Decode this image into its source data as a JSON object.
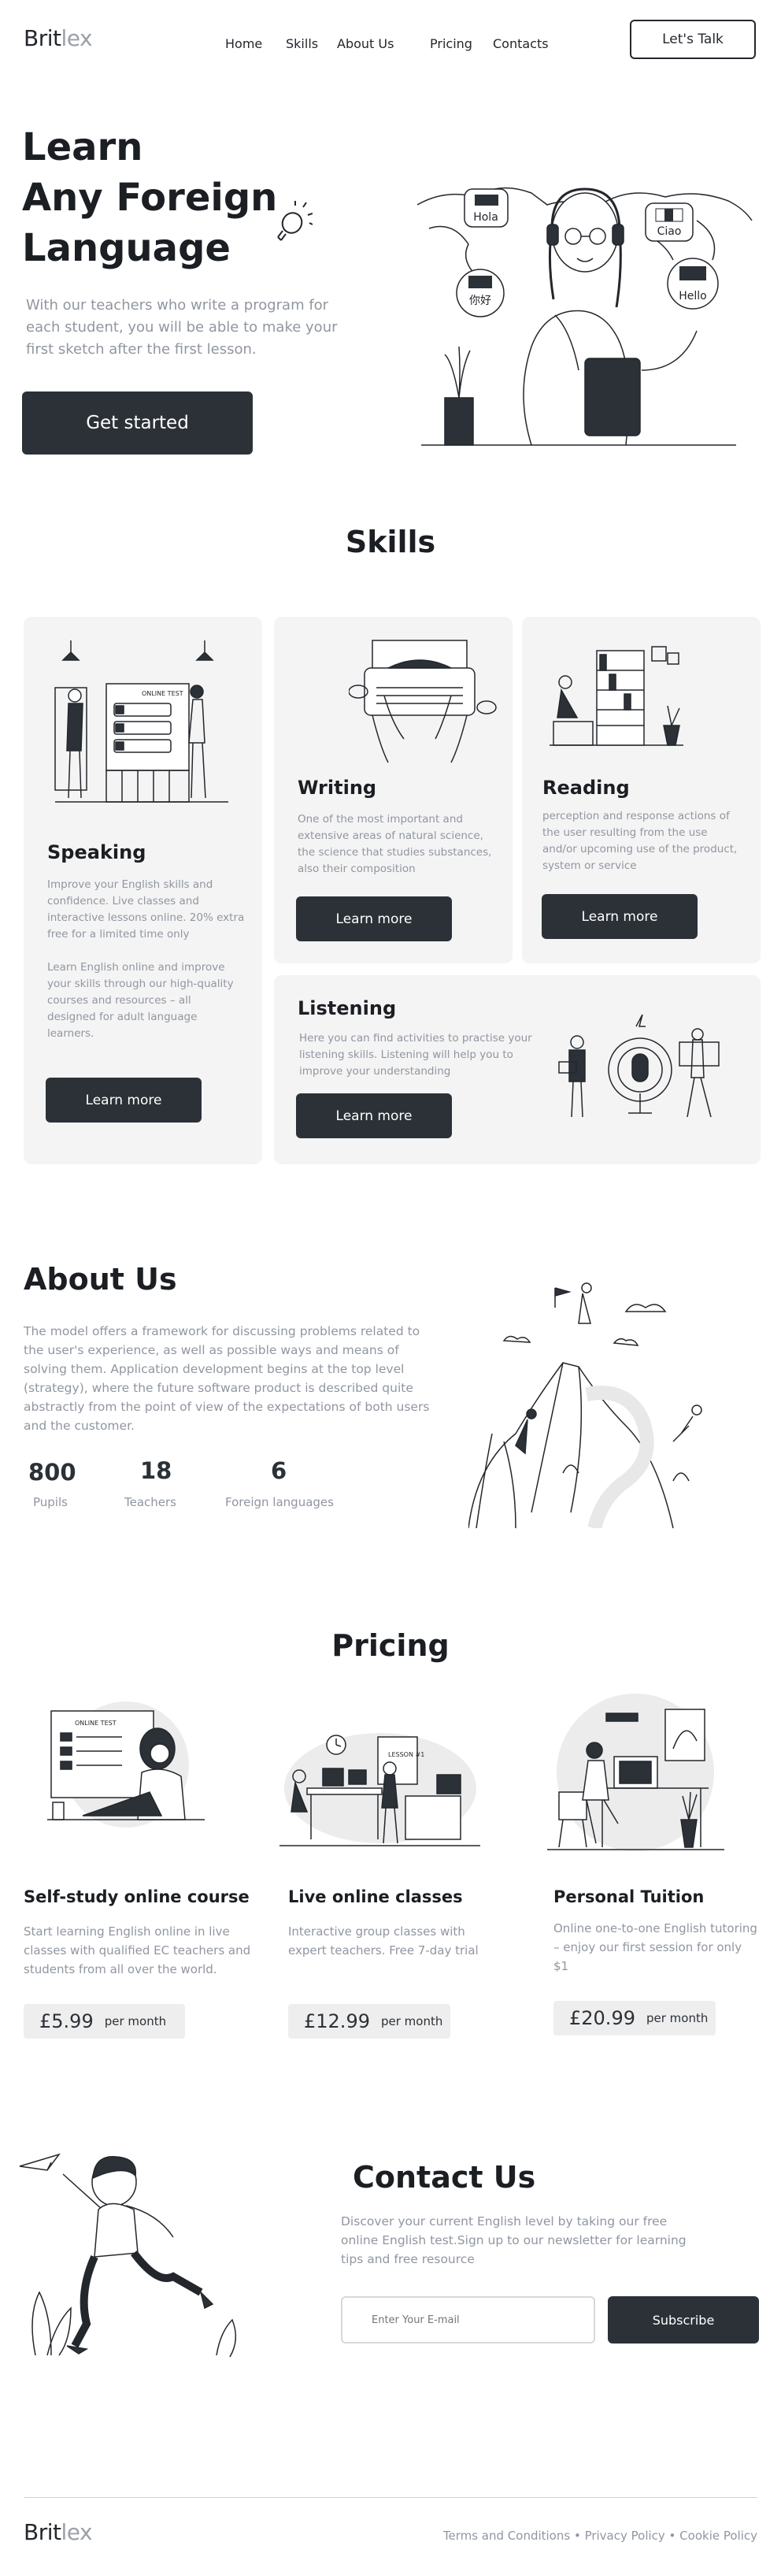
{
  "header": {
    "logo_a": "Brit",
    "logo_b": "lex",
    "nav": [
      "Home",
      "Skills",
      "About Us",
      "Pricing",
      "Contacts"
    ],
    "cta": "Let's Talk"
  },
  "hero": {
    "title_lines": [
      "Learn",
      "Any Foreign",
      "Language"
    ],
    "description": "With our teachers who write a program for each student, you will be able to make your first sketch after the first lesson.",
    "button": "Get started",
    "bubbles": [
      "Hola",
      "Ciao",
      "你好",
      "Hello"
    ]
  },
  "skills": {
    "heading": "Skills",
    "speaking": {
      "title": "Speaking",
      "p1": "Improve your English skills and confidence. Live classes and interactive lessons online. 20% extra free for a limited time only",
      "p2": "Learn English online and improve your skills through our high-quality courses and resources – all designed for adult language learners.",
      "button": "Learn more"
    },
    "writing": {
      "title": "Writing",
      "text": "One of the most important and extensive areas of natural science, the science that studies substances, also their composition",
      "button": "Learn more"
    },
    "reading": {
      "title": "Reading",
      "text": "perception and response actions of the user resulting from the use and/or upcoming use of the product, system or service",
      "button": "Learn more"
    },
    "listening": {
      "title": "Listening",
      "text": "Here you can find activities to practise your listening skills. Listening will help you to improve your understanding",
      "button": "Learn more"
    },
    "speaking_board_label": "ONLINE TEST"
  },
  "about": {
    "heading": "About Us",
    "text": "The model offers a framework for discussing problems related to the user's experience, as well as possible ways and means of solving them. Application development begins at the top level (strategy), where the future software product is described quite abstractly from the point of view of the expectations of both users and the customer.",
    "stats": [
      {
        "value": "800",
        "label": "Pupils"
      },
      {
        "value": "18",
        "label": "Teachers"
      },
      {
        "value": "6",
        "label": "Foreign languages"
      }
    ]
  },
  "pricing": {
    "heading": "Pricing",
    "unit": "per month",
    "plans": [
      {
        "title": "Self-study online course",
        "text": "Start learning English online in live classes with qualified EC teachers and students from all over the world.",
        "price": "£5.99"
      },
      {
        "title": "Live online classes",
        "text": "Interactive group classes with expert teachers. Free 7-day trial",
        "price": "£12.99"
      },
      {
        "title": "Personal Tuition",
        "text": "Online one-to-one English tutoring – enjoy our first session for only $1",
        "price": "£20.99"
      }
    ],
    "board_labels": [
      "ONLINE TEST",
      "LESSON #1"
    ]
  },
  "contact": {
    "heading": "Contact Us",
    "text": "Discover your current English level by taking our free online English test.Sign up to our newsletter for learning tips and free resource",
    "placeholder": "Enter Your E-mail",
    "button": "Subscribe"
  },
  "footer": {
    "links": "Terms and Conditions • Privacy Policy • Cookie Policy"
  }
}
